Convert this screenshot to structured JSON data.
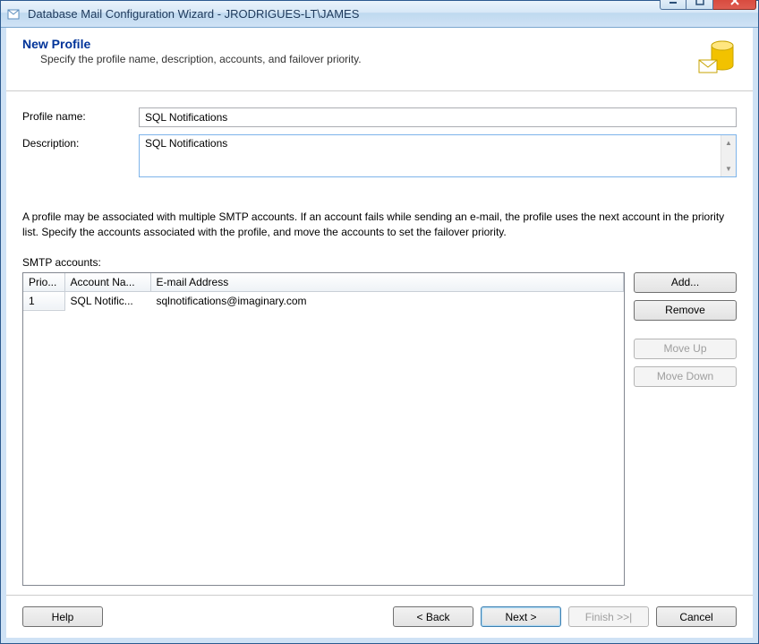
{
  "window": {
    "title": "Database Mail Configuration Wizard - JRODRIGUES-LT\\JAMES"
  },
  "header": {
    "title": "New Profile",
    "subtitle": "Specify the profile name, description, accounts, and failover priority."
  },
  "form": {
    "profile_name_label": "Profile name:",
    "profile_name_value": "SQL Notifications",
    "description_label": "Description:",
    "description_value": "SQL Notifications"
  },
  "explain_text": "A profile may be associated with multiple SMTP accounts. If an account fails while sending an e-mail, the profile uses the next account in the priority list. Specify the accounts associated with the profile, and move the accounts to set the failover priority.",
  "smtp": {
    "label": "SMTP accounts:",
    "columns": {
      "priority": "Prio...",
      "account": "Account Na...",
      "email": "E-mail Address"
    },
    "rows": [
      {
        "priority": "1",
        "account": "SQL Notific...",
        "email": "sqlnotifications@imaginary.com"
      }
    ]
  },
  "side_buttons": {
    "add": "Add...",
    "remove": "Remove",
    "move_up": "Move Up",
    "move_down": "Move Down"
  },
  "footer": {
    "help": "Help",
    "back": "< Back",
    "next": "Next >",
    "finish": "Finish >>|",
    "cancel": "Cancel"
  }
}
